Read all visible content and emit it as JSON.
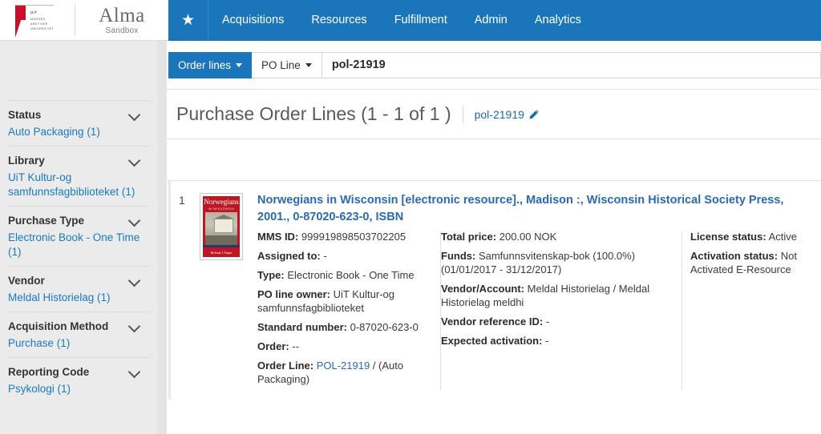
{
  "header": {
    "logo": {
      "name": "uit-logo",
      "line1": "UiT",
      "line2": "NORGES",
      "line3": "ARKTISKE",
      "line4": "UNIVERSITET"
    },
    "app_name": "Alma",
    "app_env": "Sandbox",
    "favorites_icon": "★",
    "nav": [
      {
        "label": "Acquisitions"
      },
      {
        "label": "Resources"
      },
      {
        "label": "Fulfillment"
      },
      {
        "label": "Admin"
      },
      {
        "label": "Analytics"
      }
    ],
    "accent_color": "#1b75bb"
  },
  "sidebar": {
    "facets": [
      {
        "title": "Status",
        "values": [
          "Auto Packaging (1)"
        ]
      },
      {
        "title": "Library",
        "values": [
          "UiT Kultur-og samfunnsfagbiblioteket (1)"
        ]
      },
      {
        "title": "Purchase Type",
        "values": [
          "Electronic Book - One Time (1)"
        ]
      },
      {
        "title": "Vendor",
        "values": [
          "Meldal Historielag (1)"
        ]
      },
      {
        "title": "Acquisition Method",
        "values": [
          "Purchase (1)"
        ]
      },
      {
        "title": "Reporting Code",
        "values": [
          "Psykologi (1)"
        ]
      }
    ]
  },
  "search": {
    "scope_label": "Order lines",
    "field_label": "PO Line",
    "query_value": "pol-21919",
    "placeholder": ""
  },
  "page": {
    "title": "Purchase Order Lines (1 - 1 of 1 )",
    "context_chip": "pol-21919",
    "edit_icon": "pencil-icon"
  },
  "record": {
    "index": "1",
    "cover": {
      "title_line1": "Norwegians",
      "title_line2": "IN WISCONSIN",
      "author": "Richard J. Fapso"
    },
    "title": "Norwegians in Wisconsin [electronic resource]., Madison :, Wisconsin Historical Society Press, 2001., 0-87020-623-0, ISBN",
    "col_left": [
      {
        "label": "MMS ID:",
        "value": "999919898503702205"
      },
      {
        "label": "Assigned to:",
        "value": "-"
      },
      {
        "label": "Type:",
        "value": "Electronic Book - One Time"
      },
      {
        "label": "PO line owner:",
        "value": "UiT Kultur-og samfunnsfagbiblioteket"
      },
      {
        "label": "Standard number:",
        "value": "0-87020-623-0"
      },
      {
        "label": "Order:",
        "value": "--"
      }
    ],
    "order_line": {
      "label": "Order Line:",
      "link": "POL-21919",
      "suffix": "/ (Auto Packaging)"
    },
    "col_mid": [
      {
        "label": "Total price:",
        "value": "200.00 NOK"
      },
      {
        "label": "Funds:",
        "value": "Samfunnsvitenskap-bok (100.0%) (01/01/2017 - 31/12/2017)"
      },
      {
        "label": "Vendor/Account:",
        "value": "Meldal Historielag / Meldal Historielag meldhi"
      },
      {
        "label": "Vendor reference ID:",
        "value": "-"
      },
      {
        "label": "Expected activation:",
        "value": "-"
      }
    ],
    "col_right": [
      {
        "label": "License status:",
        "value": "Active"
      },
      {
        "label": "Activation status:",
        "value": "Not Activated E-Resource"
      }
    ]
  }
}
